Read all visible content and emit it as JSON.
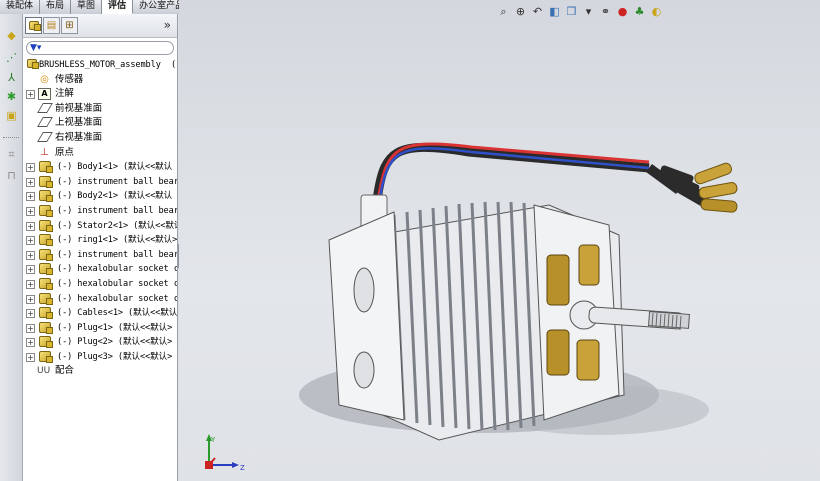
{
  "tabs": [
    "装配体",
    "布局",
    "草图",
    "评估",
    "办公室产品"
  ],
  "active_tab": "评估",
  "panel": {
    "expand_glyph": "»",
    "filter_icon": "filter-icon"
  },
  "tree": {
    "root": "BRUSHLESS_MOTOR_assembly",
    "root_suffix": "(",
    "items": [
      {
        "label": "传感器",
        "icon": "sensor-folder-icon"
      },
      {
        "label": "注解",
        "icon": "annotation-icon"
      },
      {
        "label": "前视基准面",
        "icon": "plane-icon"
      },
      {
        "label": "上视基准面",
        "icon": "plane-icon"
      },
      {
        "label": "右视基准面",
        "icon": "plane-icon"
      },
      {
        "label": "原点",
        "icon": "origin-icon"
      }
    ],
    "parts": [
      "(-) Body1<1> (默认<<默认",
      "(-) instrument ball bear:",
      "(-) Body2<1> (默认<<默认",
      "(-) instrument ball bear:",
      "(-) Stator2<1> (默认<<默认",
      "(-) ring1<1> (默认<<默认>",
      "(-) instrument ball bear:",
      "(-) hexalobular socket ch",
      "(-) hexalobular socket ch",
      "(-) hexalobular socket ch",
      "(-) Cables<1> (默认<<默认",
      "(-) Plug<1> (默认<<默认>",
      "(-) Plug<2> (默认<<默认>",
      "(-) Plug<3> (默认<<默认>"
    ],
    "mates": "配合"
  },
  "colors": {
    "motor_body": "#e9ebee",
    "winding": "#b8902a",
    "cable_red": "#d93333",
    "cable_blue": "#3050c8",
    "cable_black": "#2a2a2a"
  }
}
